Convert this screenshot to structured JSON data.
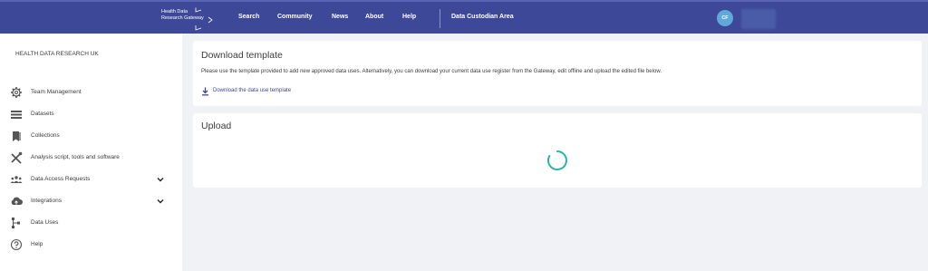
{
  "brand": {
    "line1": "Health Data",
    "line2": "Research Gateway"
  },
  "nav": {
    "items": [
      "Search",
      "Community",
      "News",
      "About",
      "Help"
    ],
    "custodian": "Data Custodian Area"
  },
  "user": {
    "initials": "CF"
  },
  "sidebar": {
    "org": "HEALTH DATA RESEARCH UK",
    "items": [
      {
        "label": "Team Management",
        "icon": "gear-icon"
      },
      {
        "label": "Datasets",
        "icon": "list-icon"
      },
      {
        "label": "Collections",
        "icon": "bookmark-icon"
      },
      {
        "label": "Analysis script, tools and software",
        "icon": "tools-icon"
      },
      {
        "label": "Data Access Requests",
        "icon": "people-icon"
      },
      {
        "label": "Integrations",
        "icon": "cloud-upload-icon"
      },
      {
        "label": "Data Uses",
        "icon": "hierarchy-icon"
      },
      {
        "label": "Help",
        "icon": "help-icon"
      }
    ]
  },
  "download": {
    "title": "Download template",
    "description": "Please use the template provided to add new approved data uses. Alternatively, you can download your current data use register from the Gateway, edit offline and upload the edited file below.",
    "link": "Download the data use template"
  },
  "upload": {
    "title": "Upload"
  },
  "colors": {
    "nav_bg": "#3e4899",
    "link": "#3e4899",
    "spinner": "#2bb5a0",
    "avatar": "#5ea9d9"
  }
}
